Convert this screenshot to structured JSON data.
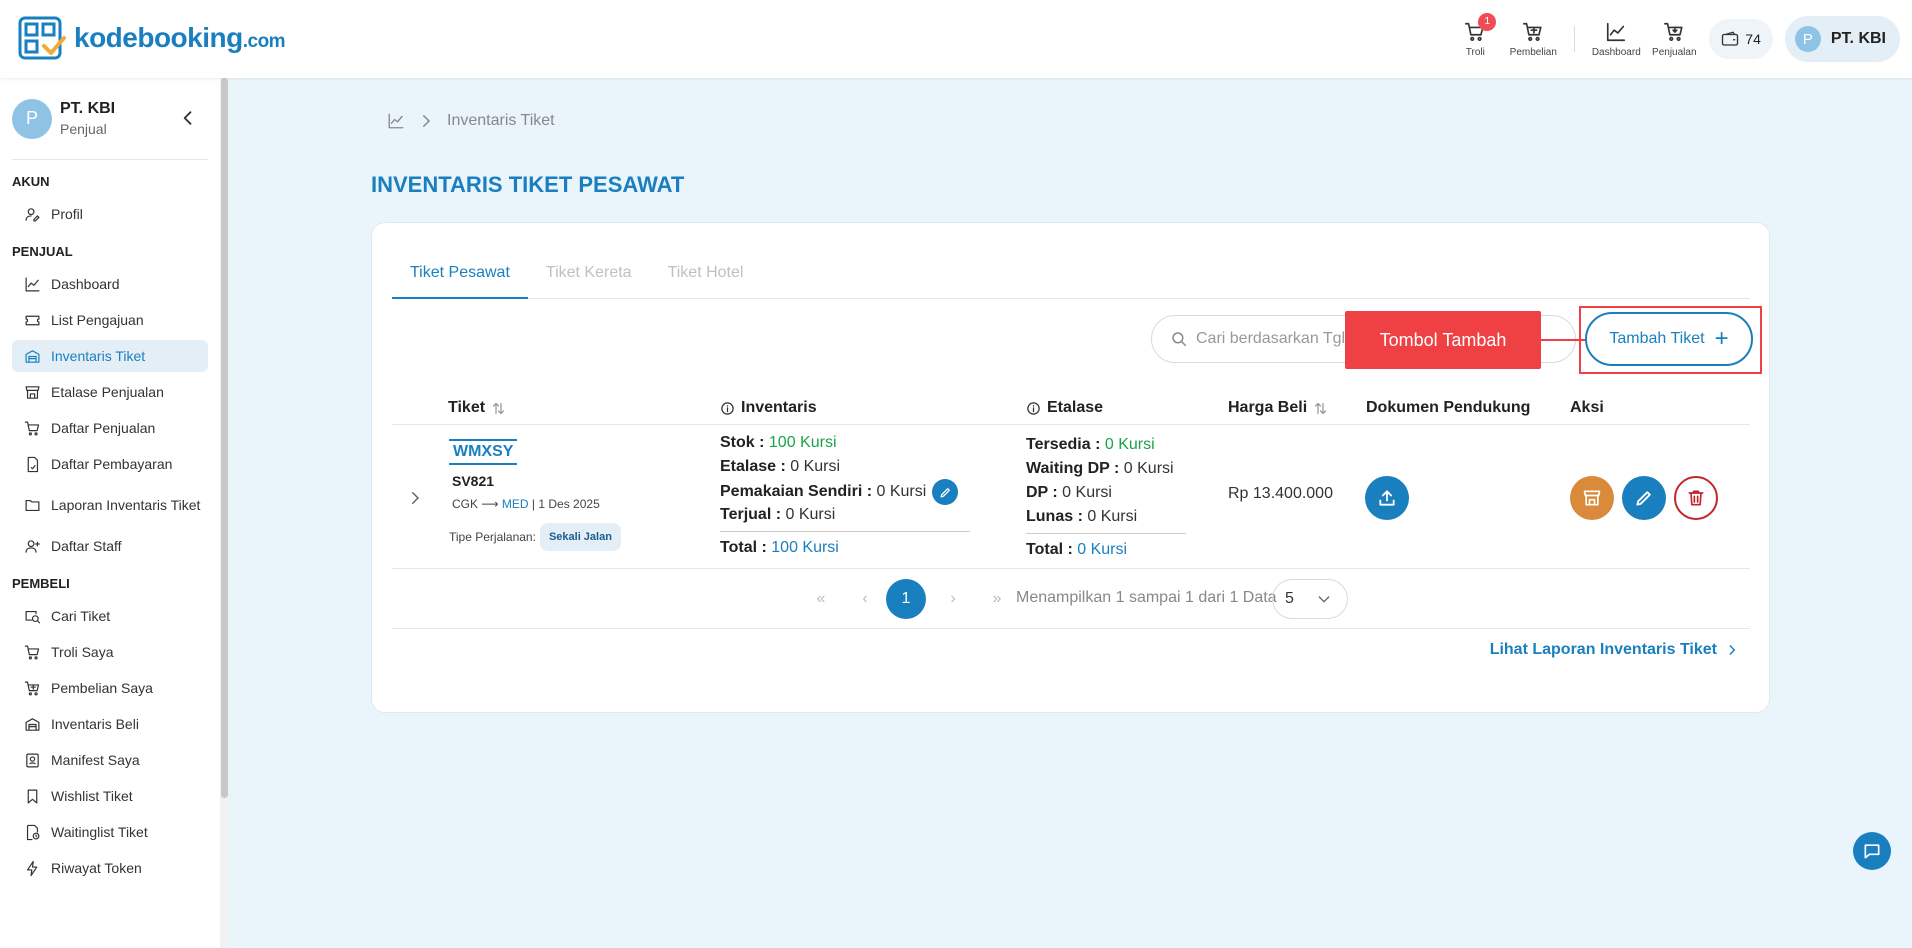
{
  "brand": {
    "name": "kodebooking",
    "domain": ".com",
    "color": "#1a7fbf"
  },
  "topnav": {
    "items": [
      {
        "label": "Troli",
        "icon": "cart-icon",
        "badge": "1"
      },
      {
        "label": "Pembelian",
        "icon": "shopping-cart-icon"
      },
      {
        "label": "Dashboard",
        "icon": "chart-icon"
      },
      {
        "label": "Penjualan",
        "icon": "sales-cart-icon"
      }
    ],
    "wallet_value": "74",
    "user_initial": "P",
    "user_name": "PT. KBI"
  },
  "sidebar": {
    "profile": {
      "initial": "P",
      "name": "PT. KBI",
      "role": "Penjual"
    },
    "sections": {
      "akun": "AKUN",
      "penjual": "PENJUAL",
      "pembeli": "PEMBELI"
    },
    "akun_items": [
      {
        "label": "Profil",
        "icon": "user-edit-icon"
      }
    ],
    "penjual_items": [
      {
        "label": "Dashboard",
        "icon": "chart-icon"
      },
      {
        "label": "List Pengajuan",
        "icon": "ticket-icon"
      },
      {
        "label": "Inventaris Tiket",
        "icon": "warehouse-icon",
        "active": true
      },
      {
        "label": "Etalase Penjualan",
        "icon": "store-icon"
      },
      {
        "label": "Daftar Penjualan",
        "icon": "sales-cart-icon"
      },
      {
        "label": "Daftar Pembayaran",
        "icon": "payment-doc-icon"
      },
      {
        "label": "Laporan Inventaris Tiket",
        "icon": "folder-icon"
      },
      {
        "label": "Daftar Staff",
        "icon": "user-plus-icon"
      }
    ],
    "pembeli_items": [
      {
        "label": "Cari Tiket",
        "icon": "search-ticket-icon"
      },
      {
        "label": "Troli Saya",
        "icon": "cart-icon"
      },
      {
        "label": "Pembelian Saya",
        "icon": "shopping-cart-icon"
      },
      {
        "label": "Inventaris Beli",
        "icon": "warehouse-icon"
      },
      {
        "label": "Manifest Saya",
        "icon": "manifest-icon"
      },
      {
        "label": "Wishlist Tiket",
        "icon": "bookmark-icon"
      },
      {
        "label": "Waitinglist Tiket",
        "icon": "clock-doc-icon"
      },
      {
        "label": "Riwayat Token",
        "icon": "lightning-icon"
      }
    ]
  },
  "breadcrumb": {
    "current": "Inventaris Tiket"
  },
  "page_title": "INVENTARIS TIKET PESAWAT",
  "tabs": [
    "Tiket Pesawat",
    "Tiket Kereta",
    "Tiket Hotel"
  ],
  "search": {
    "placeholder": "Cari berdasarkan Tgl. Berangkat"
  },
  "callout_label": "Tombol Tambah",
  "add_button": "Tambah Tiket",
  "table": {
    "headers": {
      "tiket": "Tiket",
      "inventaris": "Inventaris",
      "etalase": "Etalase",
      "harga_beli": "Harga Beli",
      "dokumen": "Dokumen Pendukung",
      "aksi": "Aksi"
    },
    "row": {
      "code": "WMXSY",
      "flight": "SV821",
      "origin": "CGK",
      "arrow": "⟶",
      "destination": "MED",
      "date": "1 Des 2025",
      "trip_label": "Tipe Perjalanan:",
      "trip_type": "Sekali Jalan",
      "inventaris": {
        "stok_label": "Stok :",
        "stok_value": "100 Kursi",
        "etalase_label": "Etalase :",
        "etalase_value": "0 Kursi",
        "pemakaian_label": "Pemakaian Sendiri :",
        "pemakaian_value": "0 Kursi",
        "terjual_label": "Terjual :",
        "terjual_value": "0 Kursi",
        "total_label": "Total :",
        "total_value": "100 Kursi"
      },
      "etalase": {
        "tersedia_label": "Tersedia :",
        "tersedia_value": "0 Kursi",
        "waiting_label": "Waiting DP :",
        "waiting_value": "0 Kursi",
        "dp_label": "DP :",
        "dp_value": "0 Kursi",
        "lunas_label": "Lunas :",
        "lunas_value": "0 Kursi",
        "total_label": "Total :",
        "total_value": "0 Kursi"
      },
      "harga_beli": "Rp 13.400.000"
    }
  },
  "pagination": {
    "current_page": "1",
    "info": "Menampilkan 1 sampai 1 dari 1 Data",
    "page_size": "5"
  },
  "report_link": "Lihat Laporan Inventaris Tiket",
  "colors": {
    "accent": "#1a7fbf",
    "danger": "#ef4044",
    "orange": "#d98a3a",
    "success": "#1aa34a"
  }
}
